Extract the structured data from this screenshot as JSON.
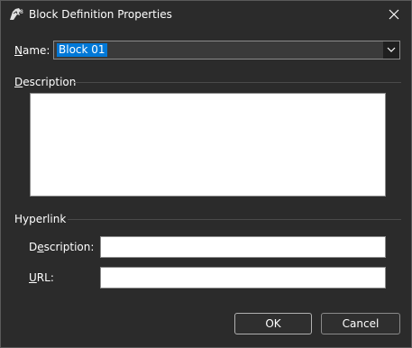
{
  "window": {
    "title": "Block Definition Properties"
  },
  "form": {
    "name_label_accel": "N",
    "name_label_rest": "ame:",
    "name_value": "Block 01",
    "description_section_accel": "D",
    "description_section_rest": "escription",
    "description_value": ""
  },
  "hyperlink": {
    "section_label": "Hyperlink",
    "description_label_pre": "D",
    "description_label_accel": "e",
    "description_label_rest": "scription:",
    "description_value": "",
    "url_label_accel": "U",
    "url_label_rest": "RL:",
    "url_value": ""
  },
  "buttons": {
    "ok_label": "OK",
    "cancel_label": "Cancel"
  },
  "icons": {
    "app": "rhino-app-icon",
    "close": "close-icon",
    "dropdown": "chevron-down-icon"
  },
  "colors": {
    "background": "#2b2b2b",
    "selection": "#0078d7",
    "input_bg": "#ffffff"
  }
}
